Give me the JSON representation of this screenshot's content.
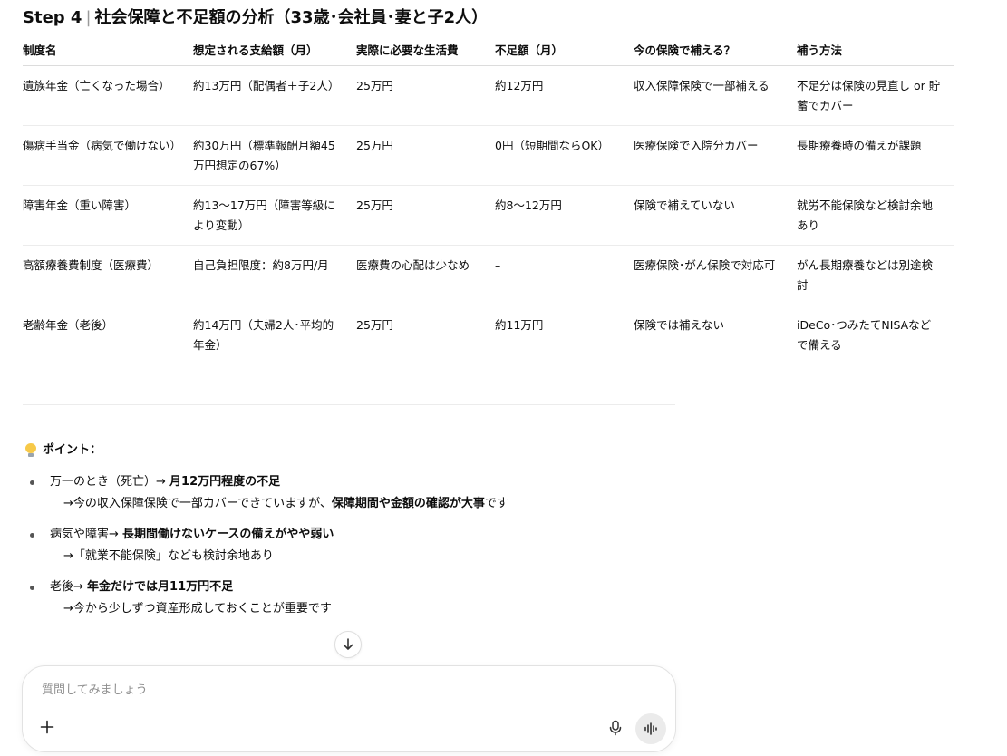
{
  "heading": {
    "step": "Step 4",
    "separator": "|",
    "title": "社会保障と不足額の分析（33歳･会社員･妻と子2人）"
  },
  "table": {
    "headers": [
      "制度名",
      "想定される支給額（月）",
      "実際に必要な生活費",
      "不足額（月）",
      "今の保険で補える？",
      "補う方法"
    ],
    "rows": [
      [
        "遺族年金（亡くなった場合）",
        "約13万円（配偶者＋子2人）",
        "25万円",
        "約12万円",
        "収入保障保険で一部補える",
        "不足分は保険の見直し or 貯蓄でカバー"
      ],
      [
        "傷病手当金（病気で働けない）",
        "約30万円（標準報酬月額45万円想定の67%）",
        "25万円",
        "0円（短期間ならOK）",
        "医療保険で入院分カバー",
        "長期療養時の備えが課題"
      ],
      [
        "障害年金（重い障害）",
        "約13〜17万円（障害等級により変動）",
        "25万円",
        "約8〜12万円",
        "保険で補えていない",
        "就労不能保険など検討余地あり"
      ],
      [
        "高額療養費制度（医療費）",
        "自己負担限度：約8万円/月",
        "医療費の心配は少なめ",
        "–",
        "医療保険･がん保険で対応可",
        "がん長期療養などは別途検討"
      ],
      [
        "老齢年金（老後）",
        "約14万円（夫婦2人･平均的年金）",
        "25万円",
        "約11万円",
        "保険では補えない",
        "iDeCo･つみたてNISAなどで備える"
      ]
    ]
  },
  "points": {
    "title": "ポイント：",
    "items": [
      {
        "lead": "万一のとき（死亡）→ ",
        "bold": "月12万円程度の不足",
        "sub_pre": "→今の収入保障保険で一部カバーできていますが、",
        "sub_bold": "保障期間や金額の確認が大事",
        "sub_post": "です"
      },
      {
        "lead": "病気や障害→ ",
        "bold": "長期間働けないケースの備えがやや弱い",
        "sub_pre": "→「就業不能保険」なども検討余地あり",
        "sub_bold": "",
        "sub_post": ""
      },
      {
        "lead": "老後→ ",
        "bold": "年金だけでは月11万円不足",
        "sub_pre": "→今から少しずつ資産形成しておくことが重要です",
        "sub_bold": "",
        "sub_post": ""
      }
    ]
  },
  "composer": {
    "placeholder": "質問してみましょう"
  },
  "icons": {
    "bulb": "lightbulb-icon",
    "scroll": "arrow-down-icon",
    "plus": "plus-icon",
    "mic": "microphone-icon",
    "voice": "voice-mode-icon"
  }
}
